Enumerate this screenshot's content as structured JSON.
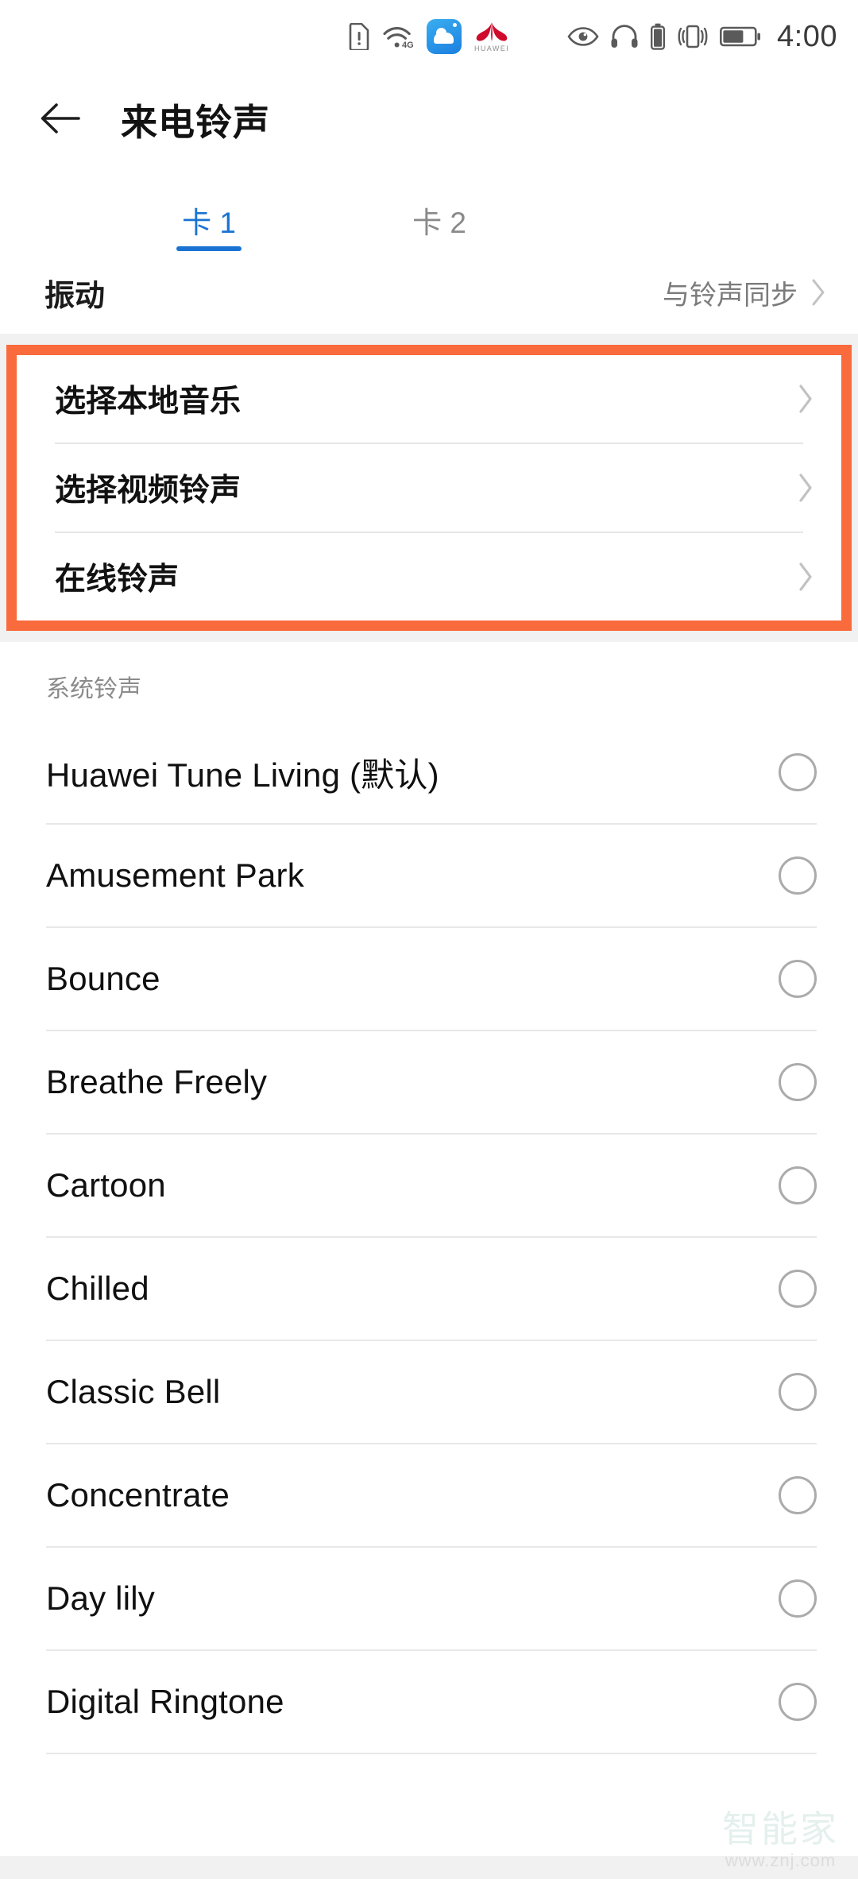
{
  "statusbar": {
    "time": "4:00",
    "left_icons": [],
    "center_icons": [
      {
        "name": "sim-card-alert-icon"
      },
      {
        "name": "wifi-4g-icon"
      },
      {
        "name": "huawei-cloud-icon"
      },
      {
        "name": "huawei-logo-icon"
      }
    ],
    "huawei_wordmark": "HUAWEI",
    "right_icons": [
      {
        "name": "eye-comfort-icon"
      },
      {
        "name": "headphone-icon"
      },
      {
        "name": "headphone-battery-icon"
      },
      {
        "name": "vibrate-icon"
      },
      {
        "name": "battery-icon"
      }
    ]
  },
  "appbar": {
    "back_icon": "back-arrow-icon",
    "title": "来电铃声"
  },
  "tabs": [
    {
      "label": "卡 1",
      "active": true
    },
    {
      "label": "卡 2",
      "active": false
    }
  ],
  "vibration": {
    "label": "振动",
    "value": "与铃声同步",
    "chevron": "chevron-right-icon"
  },
  "highlight": {
    "border_color": "#f96a3c",
    "items": [
      {
        "label": "选择本地音乐",
        "chevron": "chevron-right-icon"
      },
      {
        "label": "选择视频铃声",
        "chevron": "chevron-right-icon"
      },
      {
        "label": "在线铃声",
        "chevron": "chevron-right-icon"
      }
    ]
  },
  "system_section": {
    "header": "系统铃声",
    "ringtones": [
      {
        "name": "Huawei Tune Living (默认)",
        "selected": false
      },
      {
        "name": "Amusement Park",
        "selected": false
      },
      {
        "name": "Bounce",
        "selected": false
      },
      {
        "name": "Breathe Freely",
        "selected": false
      },
      {
        "name": "Cartoon",
        "selected": false
      },
      {
        "name": "Chilled",
        "selected": false
      },
      {
        "name": "Classic Bell",
        "selected": false
      },
      {
        "name": "Concentrate",
        "selected": false
      },
      {
        "name": "Day lily",
        "selected": false
      },
      {
        "name": "Digital Ringtone",
        "selected": false
      }
    ]
  },
  "watermark": {
    "text_cn": "智能家",
    "text_url": "www.znj.com"
  },
  "colors": {
    "accent_blue": "#1a73d2",
    "highlight_orange": "#f96a3c",
    "page_bg": "#f1f1f1",
    "card_bg": "#ffffff"
  }
}
